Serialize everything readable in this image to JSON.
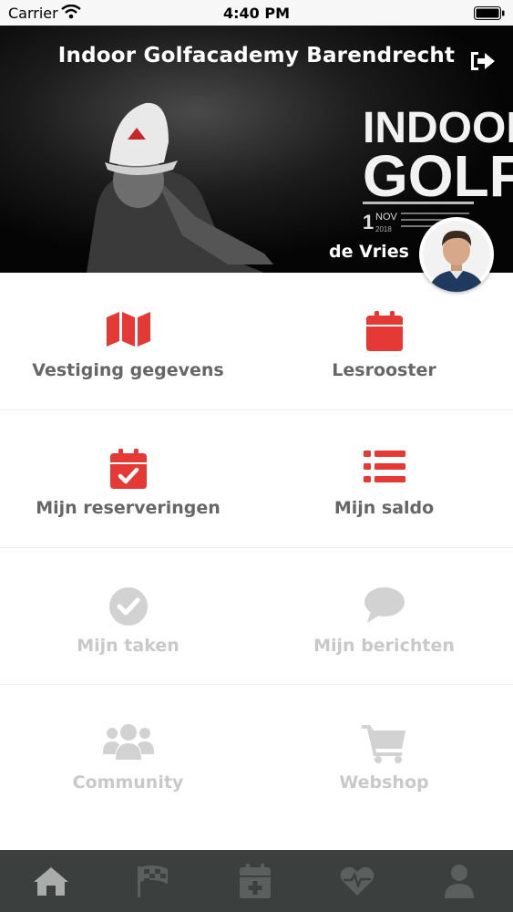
{
  "status_bar": {
    "carrier": "Carrier",
    "time": "4:40 PM"
  },
  "header": {
    "title": "Indoor Golfacademy Barendrecht",
    "user_name": "de Vries",
    "poster_text": {
      "line1": "INDOOR",
      "line2": "GOLF",
      "day": "1",
      "month": "NOV",
      "year": "2018"
    }
  },
  "menu": {
    "items": [
      {
        "label": "Vestiging gegevens",
        "icon": "map-icon",
        "enabled": true
      },
      {
        "label": "Lesrooster",
        "icon": "calendar-icon",
        "enabled": true
      },
      {
        "label": "Mijn reserveringen",
        "icon": "calendar-check-icon",
        "enabled": true
      },
      {
        "label": "Mijn saldo",
        "icon": "list-icon",
        "enabled": true
      },
      {
        "label": "Mijn taken",
        "icon": "check-circle-icon",
        "enabled": false
      },
      {
        "label": "Mijn berichten",
        "icon": "chat-bubble-icon",
        "enabled": false
      },
      {
        "label": "Community",
        "icon": "users-icon",
        "enabled": false
      },
      {
        "label": "Webshop",
        "icon": "shopping-cart-icon",
        "enabled": false
      }
    ]
  },
  "tab_bar": {
    "items": [
      {
        "icon": "home-icon",
        "active": true
      },
      {
        "icon": "checkered-flag-icon",
        "active": false
      },
      {
        "icon": "calendar-plus-icon",
        "active": false
      },
      {
        "icon": "heartbeat-icon",
        "active": false
      },
      {
        "icon": "user-icon",
        "active": false
      }
    ]
  },
  "colors": {
    "accent": "#e53935",
    "disabled": "#d2d2d2",
    "label": "#666666",
    "tab_bar": "#3b403e",
    "tab_inactive": "#5b605e",
    "tab_active": "#a9acab"
  }
}
